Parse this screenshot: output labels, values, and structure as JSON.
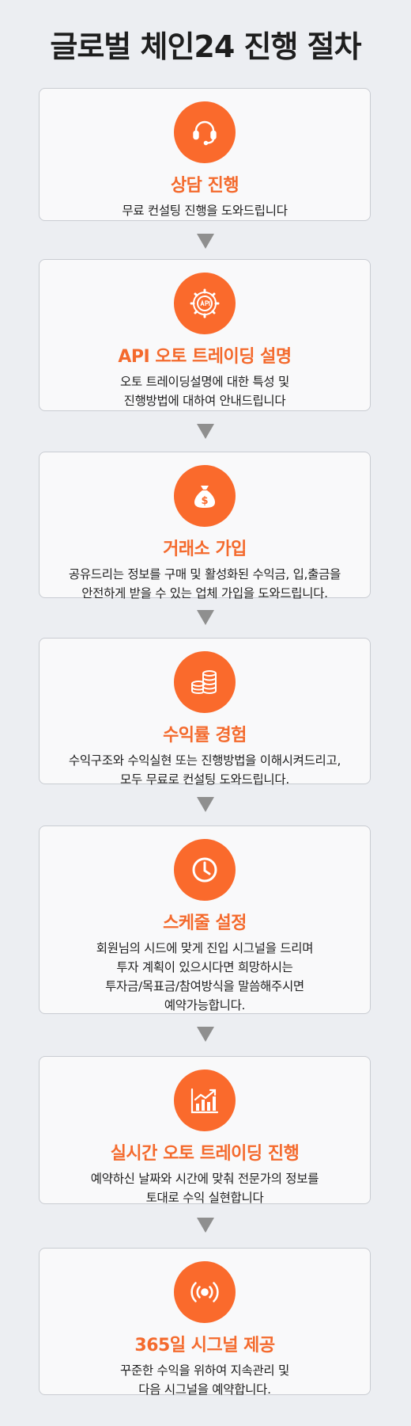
{
  "header": {
    "title": "글로벌 체인24 진행 절차"
  },
  "colors": {
    "accent": "#fa6a2c",
    "title_text": "#f46a2d",
    "arrow": "#8f8f8f",
    "card_border": "#c9ccd2"
  },
  "steps": [
    {
      "icon": "headset-icon",
      "title": "상담 진행",
      "desc": "무료 컨설팅 진행을 도와드립니다"
    },
    {
      "icon": "api-gear-icon",
      "title": "API 오토 트레이딩 설명",
      "desc": "오토 트레이딩설명에 대한 특성 및\n진행방법에 대하여 안내드립니다"
    },
    {
      "icon": "money-bag-icon",
      "title": "거래소 가입",
      "desc": "공유드리는 정보를 구매 및 활성화된 수익금, 입,출금을\n안전하게 받을 수 있는 업체 가입을 도와드립니다."
    },
    {
      "icon": "coin-stack-icon",
      "title": "수익률 경험",
      "desc": "수익구조와 수익실현 또는 진행방법을 이해시켜드리고,\n모두 무료로 컨설팅 도와드립니다."
    },
    {
      "icon": "clock-icon",
      "title": "스케줄 설정",
      "desc": "회원님의 시드에 맞게 진입 시그널을 드리며\n투자 계획이 있으시다면 희망하시는\n투자금/목표금/참여방식을 말씀해주시면\n예약가능합니다."
    },
    {
      "icon": "growth-chart-icon",
      "title": "실시간 오토 트레이딩 진행",
      "desc": "예약하신 날짜와 시간에 맞춰 전문가의 정보를\n토대로 수익 실현합니다"
    },
    {
      "icon": "broadcast-signal-icon",
      "title": "365일 시그널 제공",
      "desc": "꾸준한 수익을 위하여 지속관리 및\n다음 시그널을 예약합니다."
    }
  ]
}
